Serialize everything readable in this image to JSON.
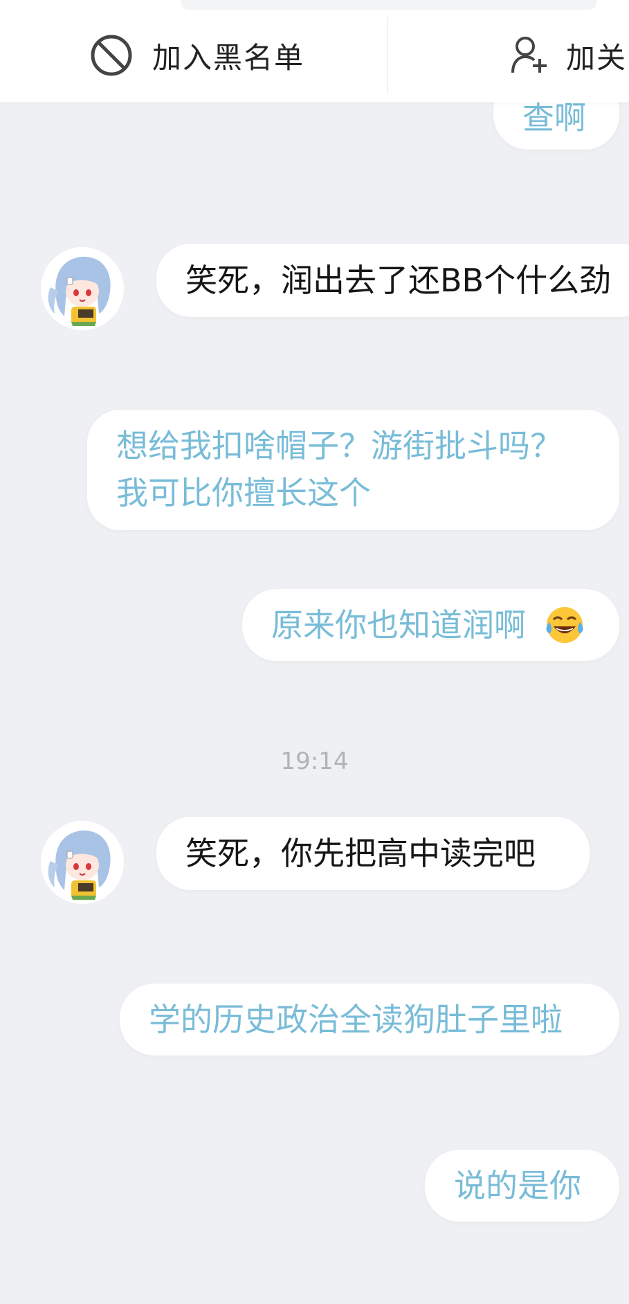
{
  "top_bar": {
    "block_label": "加入黑名单",
    "follow_label": "加关"
  },
  "messages": [
    {
      "side": "sent",
      "text": "查啊"
    },
    {
      "side": "received",
      "text": "笑死，润出去了还BB个什么劲"
    },
    {
      "side": "sent",
      "lines": [
        "想给我扣啥帽子？游街批斗吗？",
        "我可比你擅长这个"
      ]
    },
    {
      "side": "sent",
      "text": "原来你也知道润啊",
      "emoji": "😂"
    },
    {
      "side": "received",
      "text": "笑死，你先把高中读完吧"
    },
    {
      "side": "sent",
      "text": "学的历史政治全读狗肚子里啦"
    },
    {
      "side": "sent",
      "text": "说的是你"
    }
  ],
  "timestamp": "19:14",
  "colors": {
    "background": "#eef0f3",
    "sent_text": "#78bcd8",
    "received_text": "#161616",
    "timestamp": "#b1b3b6",
    "bubble": "#ffffff"
  }
}
